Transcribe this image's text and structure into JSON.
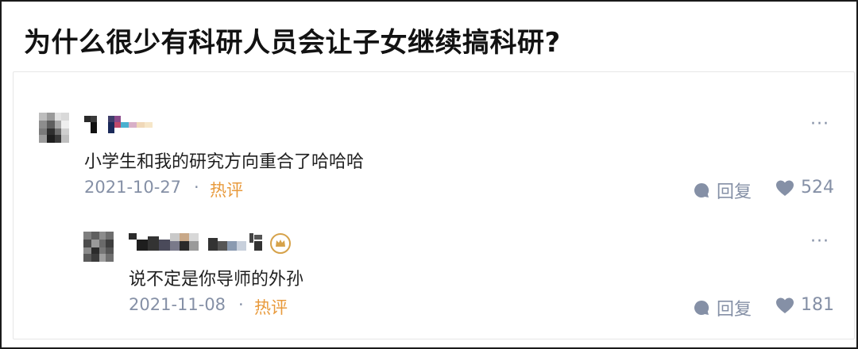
{
  "question": {
    "title": "为什么很少有科研人员会让子女继续搞科研?"
  },
  "comments": [
    {
      "text": "小学生和我的研究方向重合了哈哈哈",
      "date": "2021-10-27",
      "separator": "·",
      "tag": "热评",
      "reply_label": "回复",
      "likes": "524",
      "more": "···"
    },
    {
      "text": "说不定是你导师的外孙",
      "date": "2021-11-08",
      "separator": "·",
      "tag": "热评",
      "reply_label": "回复",
      "likes": "181",
      "more": "···"
    }
  ],
  "icons": {
    "reply": "speech-bubble-icon",
    "like": "heart-icon",
    "badge": "crown-badge-icon"
  },
  "colors": {
    "meta_gray": "#8590a6",
    "hot_tag": "#e89a3c",
    "badge": "#d6a24a"
  }
}
